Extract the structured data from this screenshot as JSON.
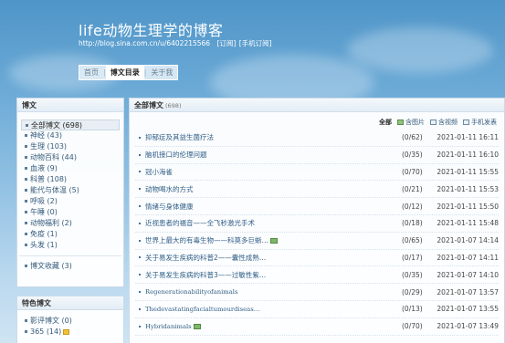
{
  "header": {
    "title": "life动物生理学的博客",
    "url": "http://blog.sina.com.cn/u/6402215566",
    "subscribe": "[订阅]",
    "mobile_subscribe": "[手机订阅]"
  },
  "nav": {
    "home": "首页",
    "catalog": "博文目录",
    "about": "关于我",
    "separator": "|"
  },
  "sidebar": {
    "title": "博文",
    "items": [
      {
        "label": "全部博文 (698)"
      },
      {
        "label": "神经 (43)"
      },
      {
        "label": "生理 (103)"
      },
      {
        "label": "动物百科 (44)"
      },
      {
        "label": "血液 (9)"
      },
      {
        "label": "科普 (108)"
      },
      {
        "label": "能代与体温 (5)"
      },
      {
        "label": "呼吸 (2)"
      },
      {
        "label": "午睡 (0)"
      },
      {
        "label": "动物福利 (2)"
      },
      {
        "label": "免疫 (1)"
      },
      {
        "label": "头发 (1)"
      }
    ],
    "favorites": "博文收藏 (3)"
  },
  "featured": {
    "title": "特色博文",
    "items": [
      {
        "label": "影评博文 (0)"
      },
      {
        "label": "365 (14)"
      }
    ]
  },
  "main": {
    "title": "全部博文",
    "count": "(698)",
    "toolbar": {
      "all": "全部",
      "pics": "含图片",
      "videos": "含视频",
      "mobile": "手机发表"
    },
    "rows": [
      {
        "title": "抑郁症及其益生菌疗法",
        "count": "(0/62)",
        "time": "2021-01-11 16:11",
        "pic": false,
        "serif": false
      },
      {
        "title": "脑机接口的伦理问题",
        "count": "(0/35)",
        "time": "2021-01-11 16:10",
        "pic": false,
        "serif": false
      },
      {
        "title": "冠小海雀",
        "count": "(0/70)",
        "time": "2021-01-11 15:55",
        "pic": false,
        "serif": false
      },
      {
        "title": "动物喝水的方式",
        "count": "(0/21)",
        "time": "2021-01-11 15:53",
        "pic": false,
        "serif": false
      },
      {
        "title": "情绪与身体健康",
        "count": "(0/12)",
        "time": "2021-01-11 15:50",
        "pic": false,
        "serif": false
      },
      {
        "title": "近视患者的福音——全飞秒激光手术",
        "count": "(0/18)",
        "time": "2021-01-11 15:48",
        "pic": false,
        "serif": false
      },
      {
        "title": "世界上最大的有毒生物——科莫多巨蜥…",
        "count": "(0/65)",
        "time": "2021-01-07 14:14",
        "pic": true,
        "serif": false
      },
      {
        "title": "关于易发生疾病的科普2——囊性成熟…",
        "count": "(0/17)",
        "time": "2021-01-07 14:11",
        "pic": false,
        "serif": false
      },
      {
        "title": "关于易发生疾病的科普3——过敏性紫…",
        "count": "(0/35)",
        "time": "2021-01-07 14:10",
        "pic": false,
        "serif": false
      },
      {
        "title": "Regenerationabilityofanimals",
        "count": "(0/29)",
        "time": "2021-01-07 13:57",
        "pic": false,
        "serif": true
      },
      {
        "title": "Thedevastatingfacialtumourdiseas…",
        "count": "(0/13)",
        "time": "2021-01-07 13:55",
        "pic": false,
        "serif": true
      },
      {
        "title": "Hybridanimals",
        "count": "(0/70)",
        "time": "2021-01-07 13:49",
        "pic": true,
        "serif": true
      }
    ]
  },
  "colors": {
    "sky_top": "#4f95c8",
    "sky_bottom": "#cfe4f3",
    "link": "#2f5d86",
    "panel_border": "#c9dbe9"
  },
  "icons": {
    "pics": "image-icon",
    "videos": "video-icon",
    "mobile": "mobile-icon",
    "post_pic": "picture-icon",
    "emoticon": "emoticon-icon"
  }
}
